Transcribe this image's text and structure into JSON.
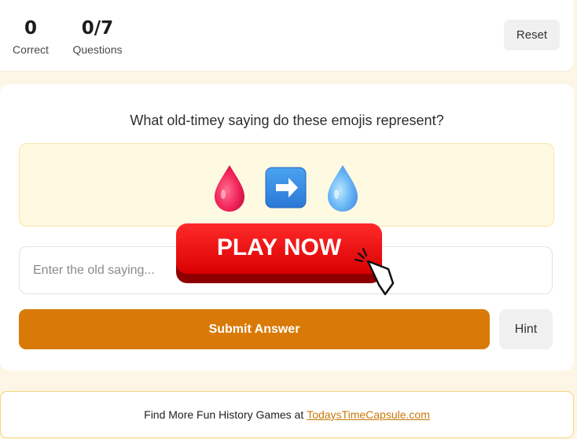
{
  "scoreboard": {
    "correct_value": "0",
    "correct_label": "Correct",
    "questions_value": "0/7",
    "questions_label": "Questions",
    "reset_label": "Reset"
  },
  "quiz": {
    "question": "What old-timey saying do these emojis represent?",
    "emojis": [
      "red-droplet",
      "right-arrow",
      "blue-droplet"
    ],
    "input_placeholder": "Enter the old saying...",
    "submit_label": "Submit Answer",
    "hint_label": "Hint"
  },
  "ad": {
    "label": "PLAY NOW"
  },
  "footer": {
    "text": "Find More Fun History Games at",
    "link_text": "TodaysTimeCapsule.com"
  },
  "colors": {
    "accent": "#d97a08",
    "page_bg": "#fdf6e6",
    "emoji_bg": "#fef9e1",
    "ad_red": "#e20a0a"
  }
}
